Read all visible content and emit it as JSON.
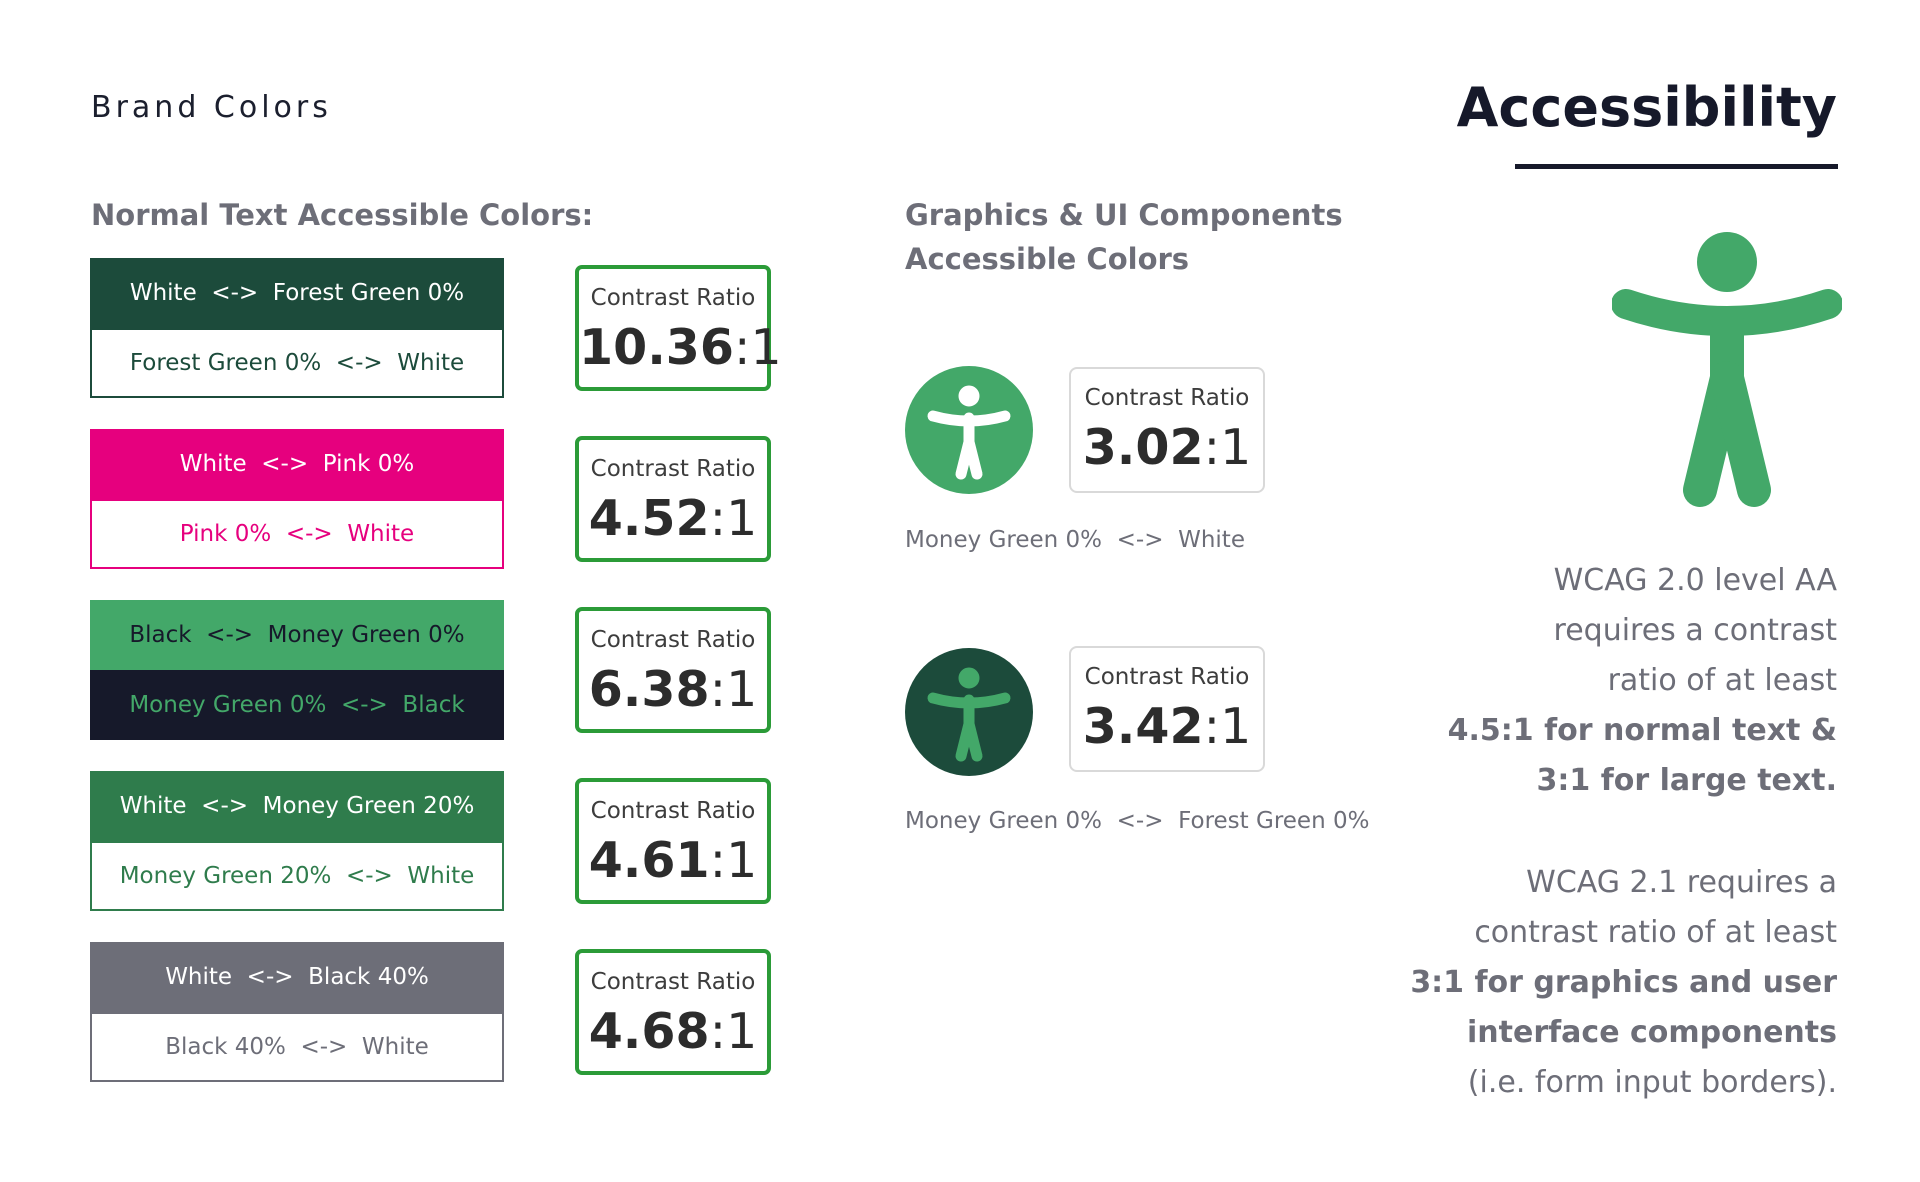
{
  "header": {
    "brand_label": "Brand Colors",
    "title": "Accessibility"
  },
  "normal_text": {
    "heading": "Normal Text Accessible Colors:",
    "pairs": [
      {
        "top": {
          "label": "White  <->  Forest Green 0%",
          "bg": "#1c4b3b",
          "fg": "#ffffff"
        },
        "bottom": {
          "label": "Forest Green 0%  <->  White",
          "bg": "#ffffff",
          "fg": "#1c4b3b",
          "border": "#1c4b3b"
        },
        "ratio_label": "Contrast Ratio",
        "ratio_value": "10.36",
        "ratio_suffix": ":1"
      },
      {
        "top": {
          "label": "White  <->  Pink 0%",
          "bg": "#e6007e",
          "fg": "#ffffff"
        },
        "bottom": {
          "label": "Pink 0%  <->  White",
          "bg": "#ffffff",
          "fg": "#e6007e",
          "border": "#e6007e"
        },
        "ratio_label": "Contrast Ratio",
        "ratio_value": "4.52",
        "ratio_suffix": ":1"
      },
      {
        "top": {
          "label": "Black  <->  Money Green 0%",
          "bg": "#43a869",
          "fg": "#16192a"
        },
        "bottom": {
          "label": "Money Green 0%  <->  Black",
          "bg": "#16192a",
          "fg": "#43a869",
          "border": "#16192a"
        },
        "ratio_label": "Contrast Ratio",
        "ratio_value": "6.38",
        "ratio_suffix": ":1"
      },
      {
        "top": {
          "label": "White  <->  Money Green 20%",
          "bg": "#2f7c4c",
          "fg": "#ffffff"
        },
        "bottom": {
          "label": "Money Green 20%  <->  White",
          "bg": "#ffffff",
          "fg": "#2f7c4c",
          "border": "#2f7c4c"
        },
        "ratio_label": "Contrast Ratio",
        "ratio_value": "4.61",
        "ratio_suffix": ":1"
      },
      {
        "top": {
          "label": "White  <->  Black 40%",
          "bg": "#6d6e78",
          "fg": "#ffffff"
        },
        "bottom": {
          "label": "Black 40%  <->  White",
          "bg": "#ffffff",
          "fg": "#6d6e78",
          "border": "#6d6e78"
        },
        "ratio_label": "Contrast Ratio",
        "ratio_value": "4.68",
        "ratio_suffix": ":1"
      }
    ],
    "ratio_border_color": "#2b9b38"
  },
  "graphics": {
    "heading_line1": "Graphics & UI Components",
    "heading_line2": "Accessible Colors",
    "items": [
      {
        "icon": "accessibility-person-icon",
        "circle_color": "#43a869",
        "figure_color": "#ffffff",
        "ratio_label": "Contrast Ratio",
        "ratio_value": "3.02",
        "ratio_suffix": ":1",
        "caption": "Money Green 0%  <->  White"
      },
      {
        "icon": "accessibility-person-icon",
        "circle_color": "#1c4b3b",
        "figure_color": "#43a869",
        "ratio_label": "Contrast Ratio",
        "ratio_value": "3.42",
        "ratio_suffix": ":1",
        "caption": "Money Green 0%  <->  Forest Green 0%"
      }
    ]
  },
  "wcag": {
    "icon": "accessibility-person-icon",
    "icon_color": "#43a869",
    "aa_lines": [
      "WCAG 2.0 level AA",
      "requires a contrast",
      "ratio of at least"
    ],
    "aa_bold_lines": [
      "4.5:1 for normal text &",
      "3:1 for large text."
    ],
    "v21_lines": [
      "WCAG 2.1 requires a",
      "contrast ratio of at least"
    ],
    "v21_bold_lines": [
      "3:1 for graphics and user",
      "interface components"
    ],
    "v21_tail": "(i.e. form input borders)."
  }
}
